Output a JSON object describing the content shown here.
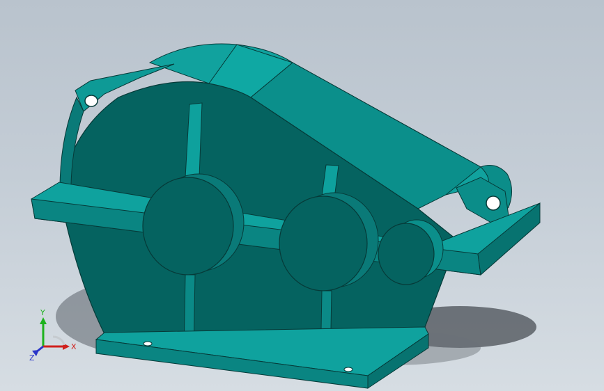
{
  "viewport": {
    "background_top": "#b9c3cd",
    "background_bottom": "#d6dde3"
  },
  "model": {
    "part": "gear-reducer",
    "body_color": "#0a7a78",
    "dark_face_color": "#056360",
    "light_face_color": "#12a09c",
    "edge_color": "#063a38",
    "shadow_color": "#4a4f55"
  },
  "triad": {
    "x_label": "X",
    "y_label": "Y",
    "z_label": "Z",
    "x_color": "#d0201c",
    "y_color": "#1db21d",
    "z_color": "#2a35c8"
  }
}
